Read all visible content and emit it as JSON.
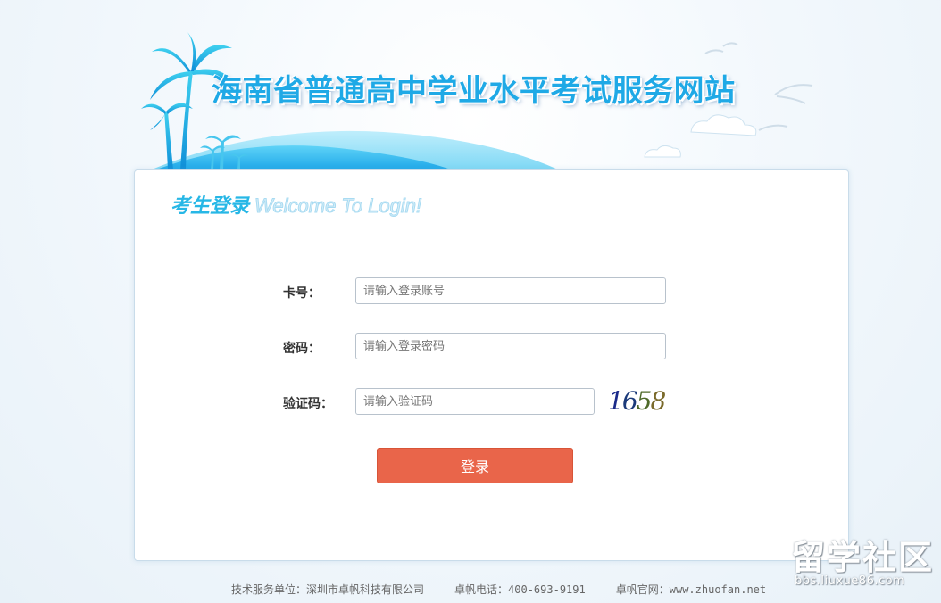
{
  "header": {
    "site_title": "海南省普通高中学业水平考试服务网站"
  },
  "login": {
    "title": "考生登录",
    "subtitle": "Welcome To Login!",
    "card_label": "卡号：",
    "card_placeholder": "请输入登录账号",
    "password_label": "密码：",
    "password_placeholder": "请输入登录密码",
    "captcha_label": "验证码：",
    "captcha_placeholder": "请输入验证码",
    "captcha_digits": [
      "1",
      "6",
      "5",
      "8"
    ],
    "submit_label": "登录"
  },
  "footer": {
    "tech_label": "技术服务单位：深圳市卓帆科技有限公司",
    "phone_label": "卓帆电话：",
    "phone": "400-693-9191",
    "site_label": "卓帆官网：",
    "site": "www.zhuofan.net"
  },
  "watermark": {
    "title": "留学社区",
    "url": "bbs.liuxue86.com"
  },
  "colors": {
    "accent": "#1fa9e6",
    "button": "#e9654a",
    "captcha": [
      "#1b2a8a",
      "#1b3a7a",
      "#4f6a2a",
      "#7a6a2a"
    ]
  }
}
